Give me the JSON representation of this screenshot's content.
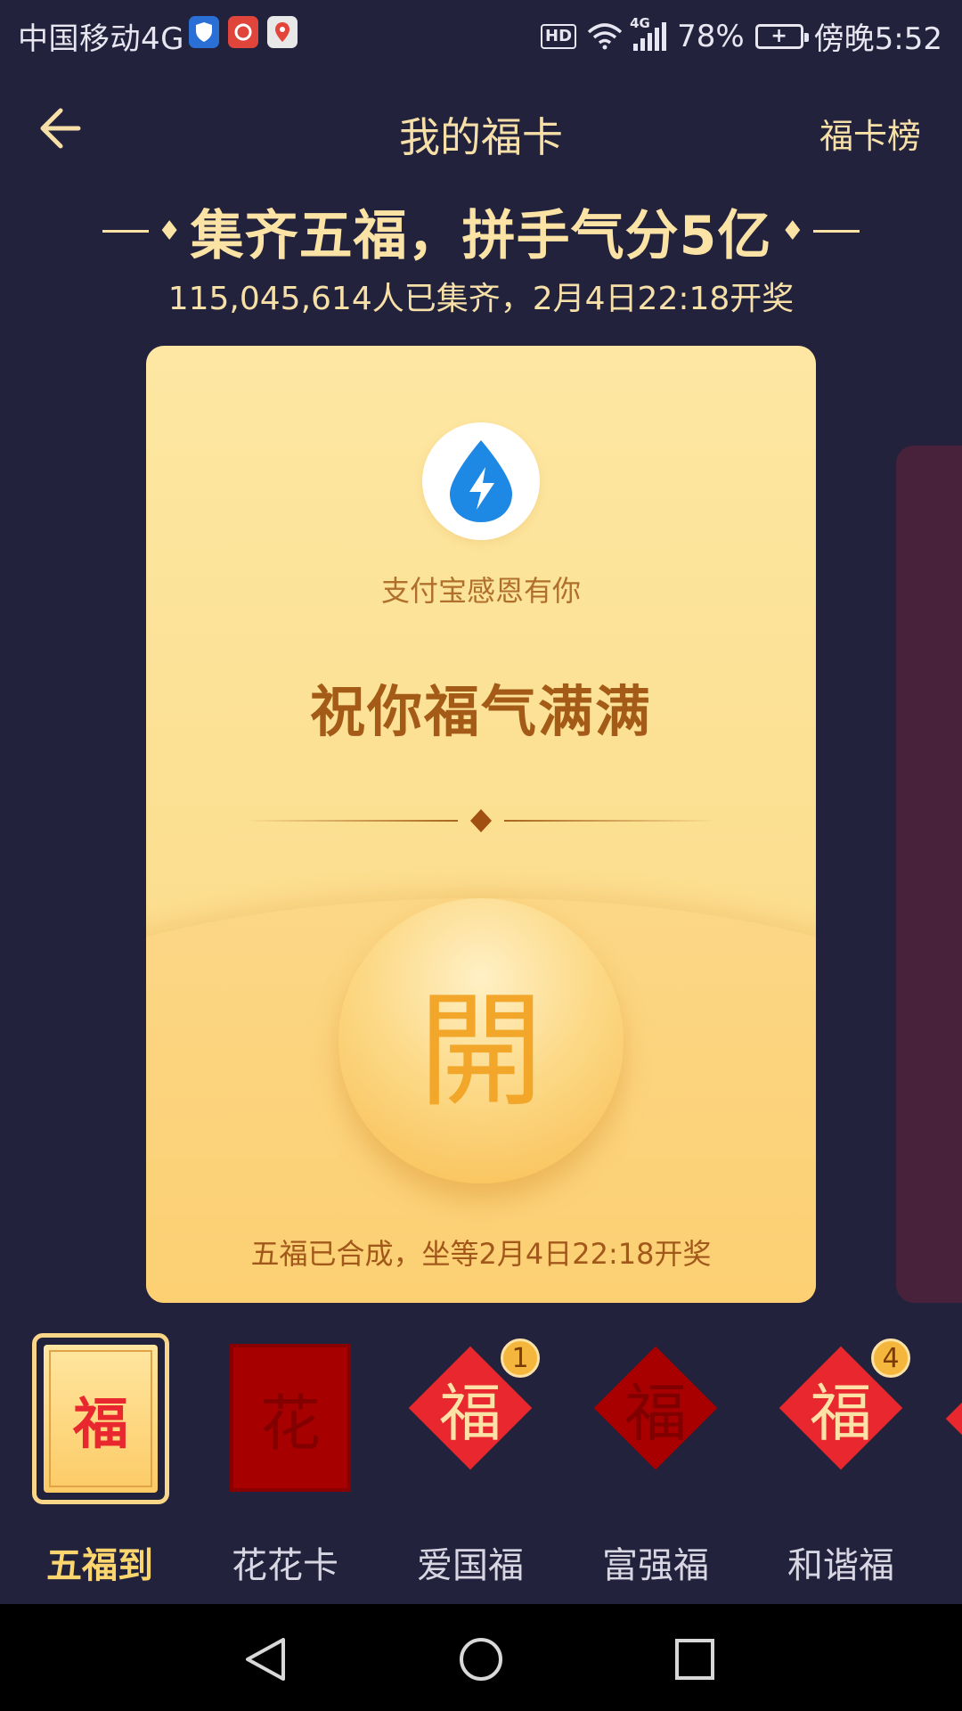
{
  "status_bar": {
    "carrier": "中国移动4G",
    "hd": "HD",
    "network": "4G",
    "battery": "78%",
    "time": "傍晚5:52"
  },
  "header": {
    "title": "我的福卡",
    "ranking_link": "福卡榜"
  },
  "headline": "集齐五福，拼手气分5亿",
  "subline": "115,045,614人已集齐，2月4日22:18开奖",
  "card": {
    "sub": "支付宝感恩有你",
    "title": "祝你福气满满",
    "open_char": "開",
    "footer": "五福已合成，坐等2月4日22:18开奖"
  },
  "cards": [
    {
      "label": "五福到",
      "selected": true
    },
    {
      "label": "花花卡",
      "glyph": "花"
    },
    {
      "label": "爱国福",
      "glyph": "福",
      "count": "1"
    },
    {
      "label": "富强福",
      "glyph": "福"
    },
    {
      "label": "和谐福",
      "glyph": "福",
      "count": "4"
    }
  ],
  "colors": {
    "background": "#23223c",
    "accent": "#fbe3a6",
    "card": "#fde7a2",
    "fu_red": "#e8282e"
  }
}
